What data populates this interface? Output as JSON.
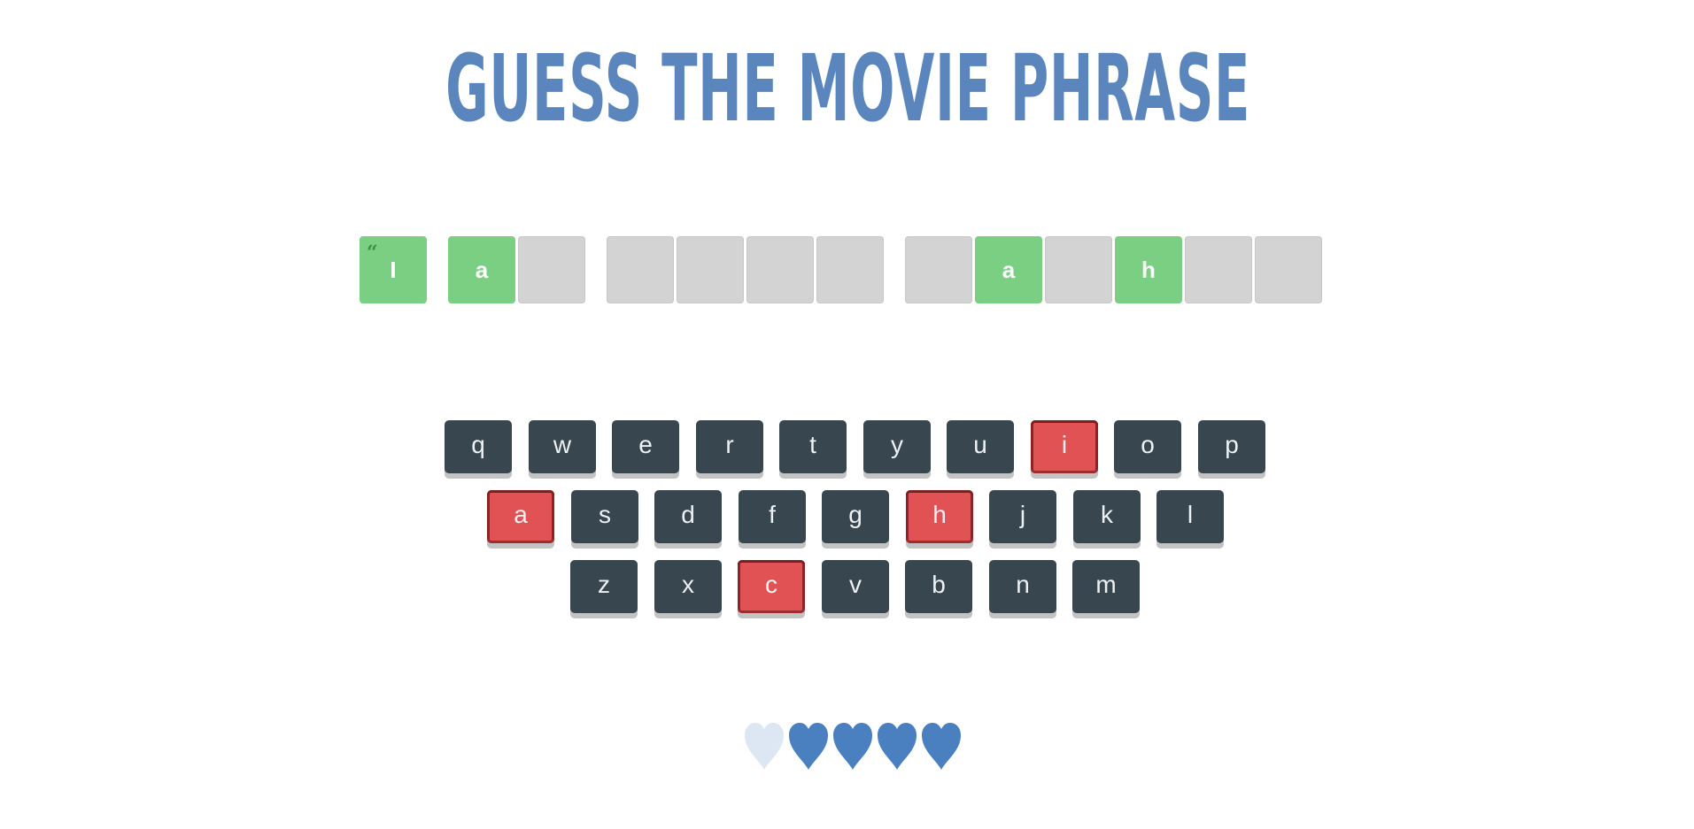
{
  "game": {
    "title": "GUESS THE MOVIE PHRASE",
    "opening_quote_mark": "“",
    "phrase_words": [
      [
        {
          "letter": "I",
          "revealed": true
        }
      ],
      [
        {
          "letter": "a",
          "revealed": true
        },
        {
          "letter": "",
          "revealed": false
        }
      ],
      [
        {
          "letter": "",
          "revealed": false
        },
        {
          "letter": "",
          "revealed": false
        },
        {
          "letter": "",
          "revealed": false
        },
        {
          "letter": "",
          "revealed": false
        }
      ],
      [
        {
          "letter": "",
          "revealed": false
        },
        {
          "letter": "a",
          "revealed": true
        },
        {
          "letter": "",
          "revealed": false
        },
        {
          "letter": "h",
          "revealed": true
        },
        {
          "letter": "",
          "revealed": false
        },
        {
          "letter": "",
          "revealed": false
        }
      ]
    ]
  },
  "keyboard": {
    "rows": [
      [
        "q",
        "w",
        "e",
        "r",
        "t",
        "y",
        "u",
        "i",
        "o",
        "p"
      ],
      [
        "a",
        "s",
        "d",
        "f",
        "g",
        "h",
        "j",
        "k",
        "l"
      ],
      [
        "z",
        "x",
        "c",
        "v",
        "b",
        "n",
        "m"
      ]
    ],
    "used_letters": [
      "i",
      "a",
      "h",
      "c"
    ]
  },
  "lives": {
    "total": 5,
    "remaining": 4,
    "icon": "heart-icon",
    "full_color": "#4a7fc0",
    "lost_color": "#dde7f3"
  },
  "colors": {
    "title": "#5a86bd",
    "tile_revealed": "#7bcf82",
    "tile_hidden": "#d3d3d3",
    "key_default": "#37464f",
    "key_used": "#e15254"
  }
}
